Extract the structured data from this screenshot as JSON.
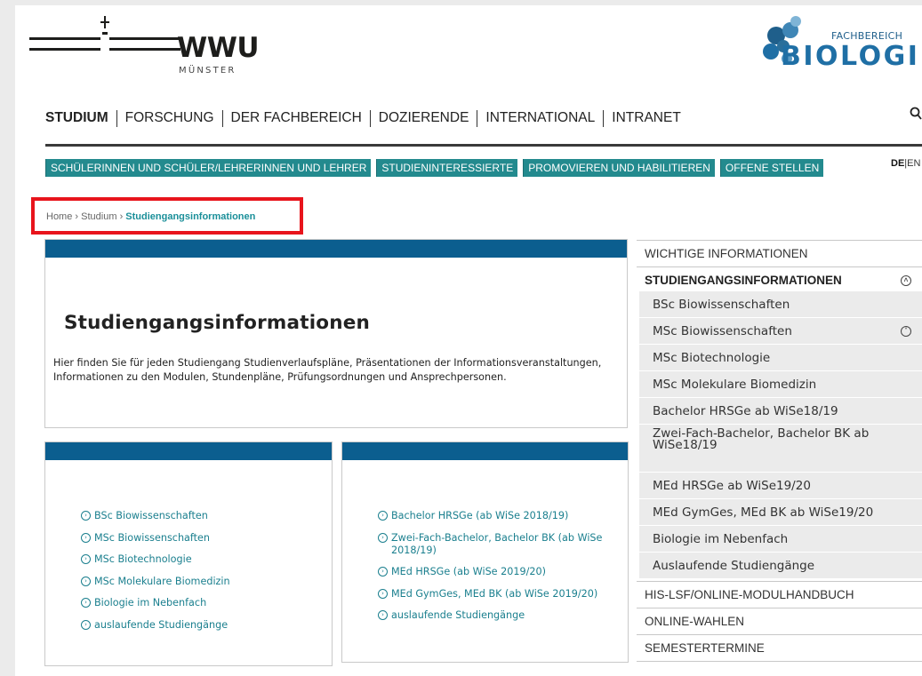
{
  "header": {
    "university_logo_text": "WWU",
    "university_logo_subtext": "MÜNSTER",
    "faculty_logo_small": "FACHBEREICH",
    "faculty_logo_big": "BIOLOGIE"
  },
  "main_nav": [
    "STUDIUM",
    "FORSCHUNG",
    "DER FACHBEREICH",
    "DOZIERENDE",
    "INTERNATIONAL",
    "INTRANET"
  ],
  "sub_nav": [
    "SCHÜLERINNEN UND SCHÜLER/LEHRERINNEN UND LEHRER",
    "STUDIENINTERESSIERTE",
    "PROMOVIEREN UND HABILITIEREN",
    "OFFENE STELLEN"
  ],
  "language": {
    "active": "DE",
    "separator": "|",
    "other": "EN"
  },
  "breadcrumb": {
    "home": "Home",
    "sep": "›",
    "level1": "Studium",
    "current": "Studiengangsinformationen"
  },
  "intro": {
    "title": "Studiengangsinformationen",
    "text": "Hier finden Sie für jeden Studiengang Studienverlaufspläne, Präsentationen der Informationsveranstaltungen, Informationen zu den Modulen, Stundenpläne, Prüfungsordnungen und Ansprechpersonen."
  },
  "links_col1": [
    "BSc Biowissenschaften",
    "MSc Biowissenschaften",
    "MSc Biotechnologie",
    "MSc Molekulare Biomedizin",
    "Biologie im Nebenfach",
    "auslaufende Studiengänge"
  ],
  "links_col2": [
    "Bachelor HRSGe (ab WiSe 2018/19)",
    "Zwei-Fach-Bachelor, Bachelor BK (ab WiSe 2018/19)",
    "MEd HRSGe (ab WiSe 2019/20)",
    "MEd GymGes, MEd BK (ab WiSe 2019/20)",
    "auslaufende Studiengänge"
  ],
  "side_nav": {
    "top_item": "WICHTIGE INFORMATIONEN",
    "group_title": "STUDIENGANGSINFORMATIONEN",
    "group_items": [
      "BSc Biowissenschaften",
      "MSc Biowissenschaften",
      "MSc Biotechnologie",
      "MSc Molekulare Biomedizin",
      "Bachelor HRSGe ab WiSe18/19",
      "Zwei-Fach-Bachelor, Bachelor BK ab WiSe18/19",
      "MEd HRSGe ab WiSe19/20",
      "MEd GymGes, MEd BK ab WiSe19/20",
      "Biologie im Nebenfach",
      "Auslaufende Studiengänge"
    ],
    "after_items": [
      "HIS-LSF/ONLINE-MODULHANDBUCH",
      "ONLINE-WAHLEN",
      "SEMESTERTERMINE"
    ]
  },
  "icons": {
    "link_bullet": "chevron-right-circle-icon",
    "collapse": "chevron-up-circle-icon",
    "expand": "chevron-down-circle-icon",
    "search": "search-icon"
  },
  "colors": {
    "teal": "#238a8e",
    "bar_blue": "#0b5e8f",
    "link": "#1a7f8e",
    "highlight": "#e8141c"
  }
}
